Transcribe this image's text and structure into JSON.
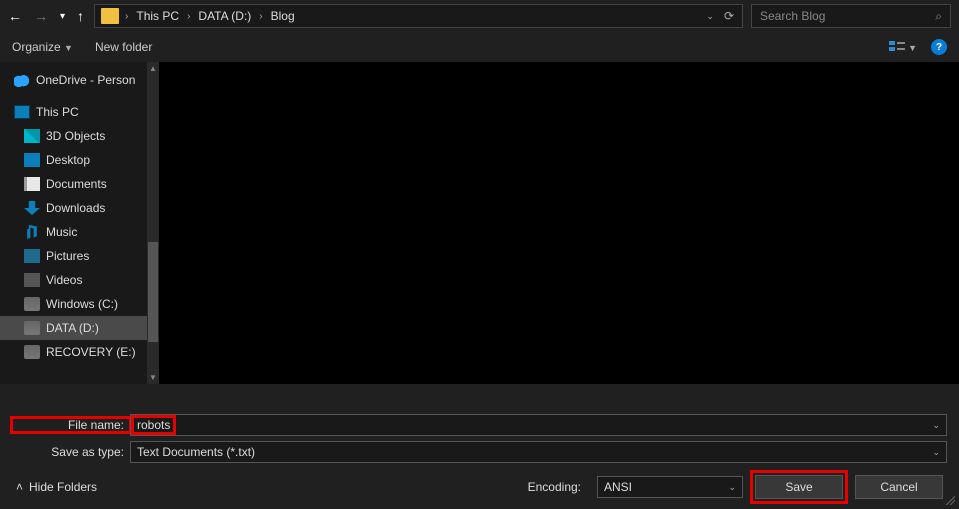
{
  "nav": {
    "path": [
      "This PC",
      "DATA (D:)",
      "Blog"
    ],
    "search_placeholder": "Search Blog"
  },
  "toolbar": {
    "organize": "Organize",
    "newfolder": "New folder"
  },
  "sidebar": {
    "onedrive": "OneDrive - Person",
    "thispc": "This PC",
    "items": [
      "3D Objects",
      "Desktop",
      "Documents",
      "Downloads",
      "Music",
      "Pictures",
      "Videos",
      "Windows (C:)",
      "DATA (D:)",
      "RECOVERY (E:)"
    ]
  },
  "form": {
    "filename_label": "File name:",
    "filename_value": "robots",
    "saveas_label": "Save as type:",
    "saveas_value": "Text Documents (*.txt)"
  },
  "actions": {
    "hide_folders": "Hide Folders",
    "encoding_label": "Encoding:",
    "encoding_value": "ANSI",
    "save": "Save",
    "cancel": "Cancel"
  }
}
